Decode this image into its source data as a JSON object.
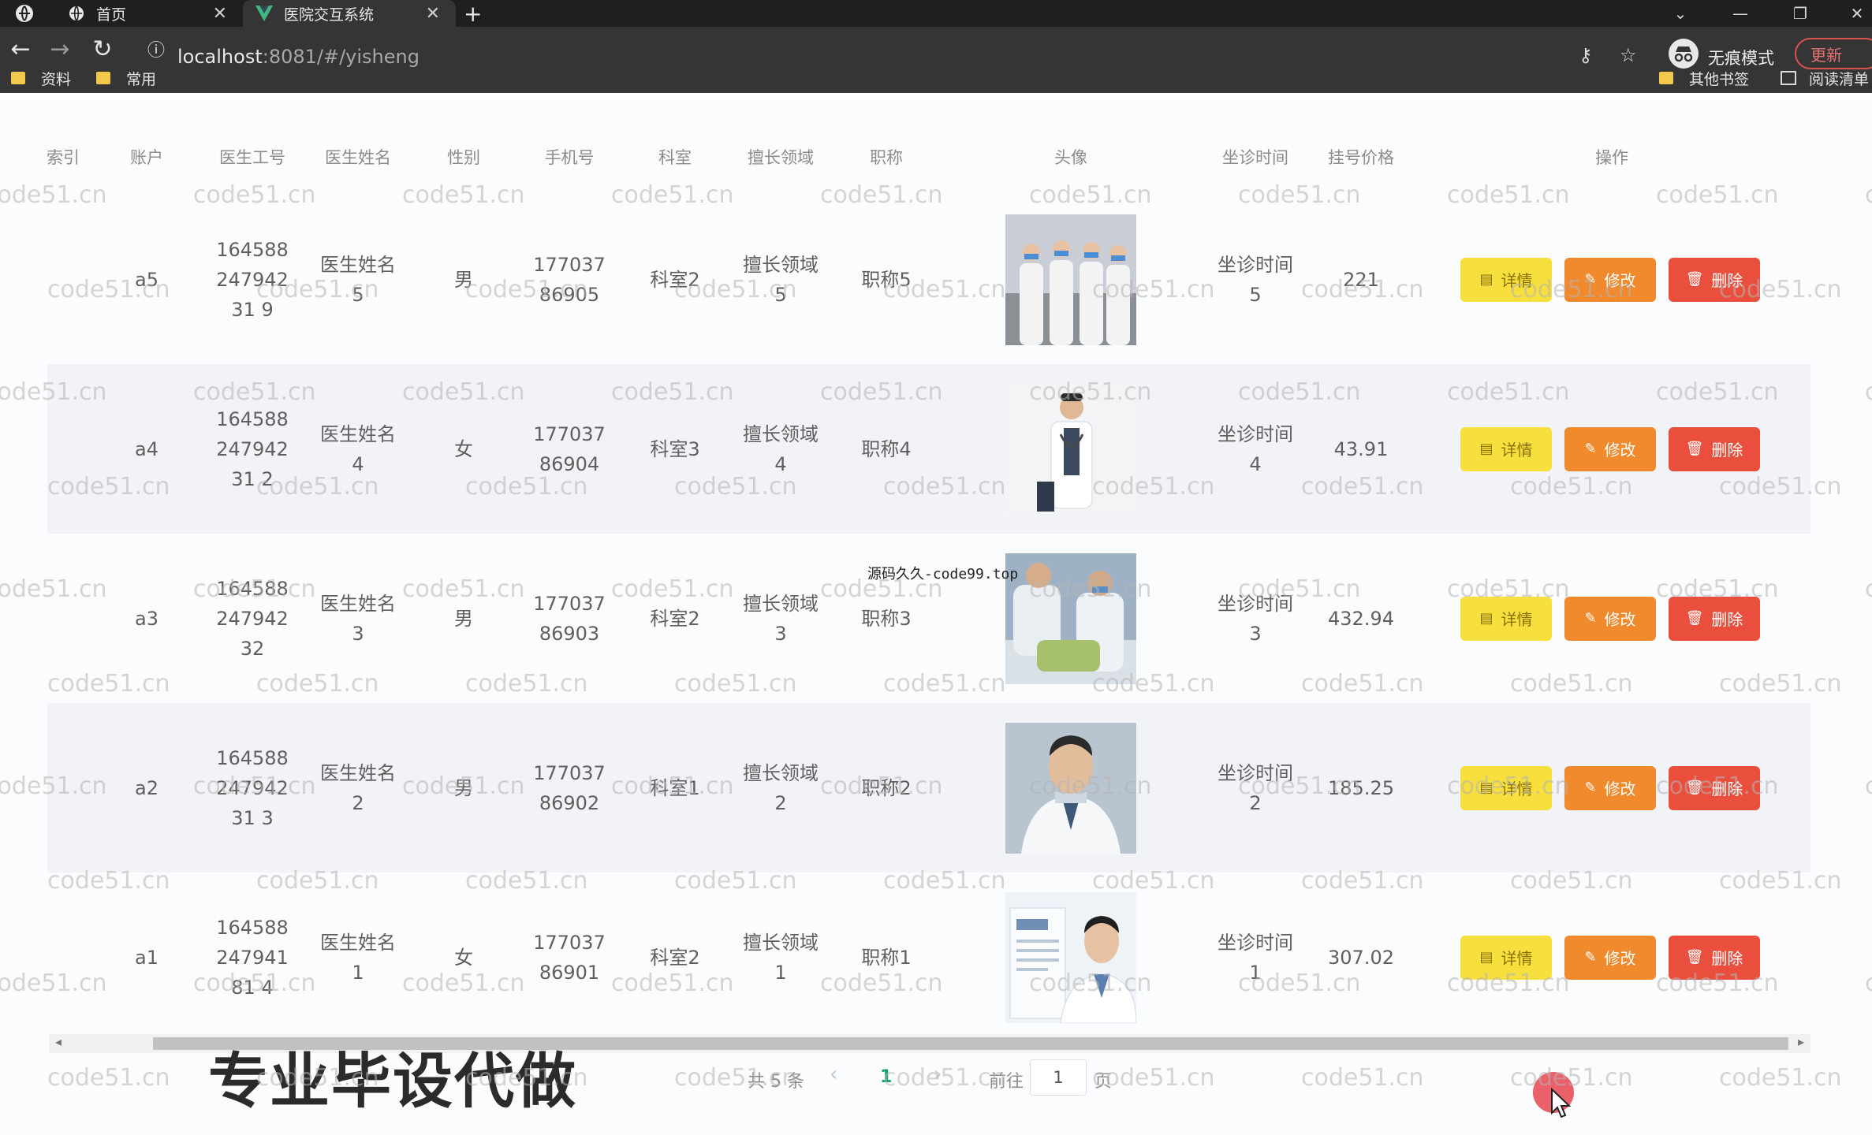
{
  "browser": {
    "tabs": [
      {
        "label": "首页",
        "icon": "globe-icon"
      },
      {
        "label": "医院交互系统",
        "icon": "vue-logo-icon"
      }
    ],
    "url_host": "localhost",
    "url_rest": ":8081/#/yisheng",
    "incognito_label": "无痕模式",
    "update_label": "更新",
    "bookmarks": [
      "资料",
      "常用"
    ],
    "other_bookmarks": "其他书签",
    "reading_list": "阅读清单"
  },
  "table": {
    "columns": [
      "索引",
      "账户",
      "医生工号",
      "医生姓名",
      "性别",
      "手机号",
      "科室",
      "擅长领域",
      "职称",
      "头像",
      "坐诊时间",
      "挂号价格",
      "操作"
    ],
    "rows": [
      {
        "account": "a5",
        "doctor_no": "16458824794231 9",
        "name": "医生姓名5",
        "gender": "男",
        "phone": "17703786905",
        "dept": "科室2",
        "specialty": "擅长领域5",
        "title": "职称5",
        "time": "坐诊时间5",
        "price": "221"
      },
      {
        "account": "a4",
        "doctor_no": "16458824794231 2",
        "name": "医生姓名4",
        "gender": "女",
        "phone": "17703786904",
        "dept": "科室3",
        "specialty": "擅长领域4",
        "title": "职称4",
        "time": "坐诊时间4",
        "price": "43.91"
      },
      {
        "account": "a3",
        "doctor_no": "16458824794232",
        "name": "医生姓名3",
        "gender": "男",
        "phone": "17703786903",
        "dept": "科室2",
        "specialty": "擅长领域3",
        "title": "职称3",
        "time": "坐诊时间3",
        "price": "432.94"
      },
      {
        "account": "a2",
        "doctor_no": "16458824794231 3",
        "name": "医生姓名2",
        "gender": "男",
        "phone": "17703786902",
        "dept": "科室1",
        "specialty": "擅长领域2",
        "title": "职称2",
        "time": "坐诊时间2",
        "price": "185.25"
      },
      {
        "account": "a1",
        "doctor_no": "16458824794181 4",
        "name": "医生姓名1",
        "gender": "女",
        "phone": "17703786901",
        "dept": "科室2",
        "specialty": "擅长领域1",
        "title": "职称1",
        "time": "坐诊时间1",
        "price": "307.02"
      }
    ],
    "actions": {
      "detail": "详情",
      "edit": "修改",
      "delete": "删除"
    }
  },
  "pagination": {
    "total": "共 5 条",
    "prev": "‹",
    "current": "1",
    "next": "›",
    "goto": "前往",
    "page_input": "1",
    "page_suffix": "页"
  },
  "overlay": {
    "promo": "专业毕设代做",
    "ad": "源码久久-code99.top",
    "watermark": "code51.cn"
  },
  "colors": {
    "detail": "#f7df3d",
    "edit": "#f1892d",
    "delete": "#ea4f3d",
    "link_active": "#13a36c"
  }
}
